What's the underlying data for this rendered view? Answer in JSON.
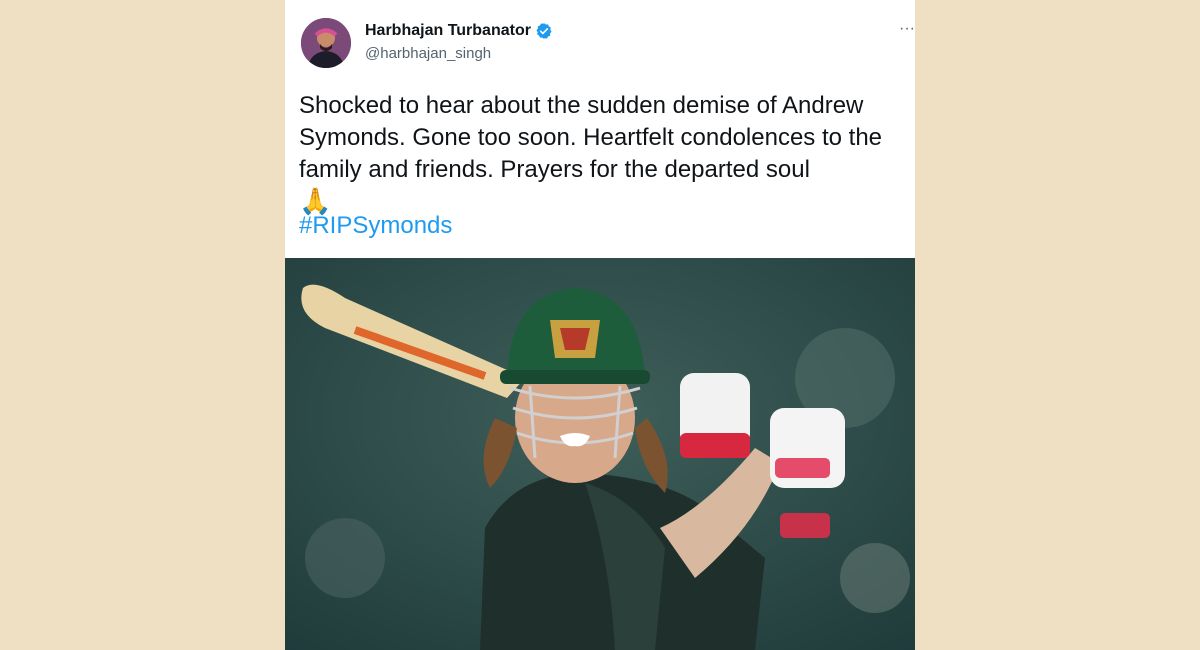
{
  "tweet": {
    "author_name": "Harbhajan Turbanator",
    "author_handle": "@harbhajan_singh",
    "more_label": "···",
    "text": "Shocked to hear about the sudden demise of Andrew Symonds. Gone too soon. Heartfelt condolences to the family and friends. Prayers for the departed soul",
    "emoji": "🙏",
    "hashtag": "#RIPSymonds"
  },
  "colors": {
    "page_background": "#efe0c4",
    "hashtag": "#1d9bf0",
    "verified_badge": "#1d9bf0"
  },
  "icons": [
    "verified-badge-icon",
    "more-options-icon",
    "folded-hands-emoji"
  ]
}
